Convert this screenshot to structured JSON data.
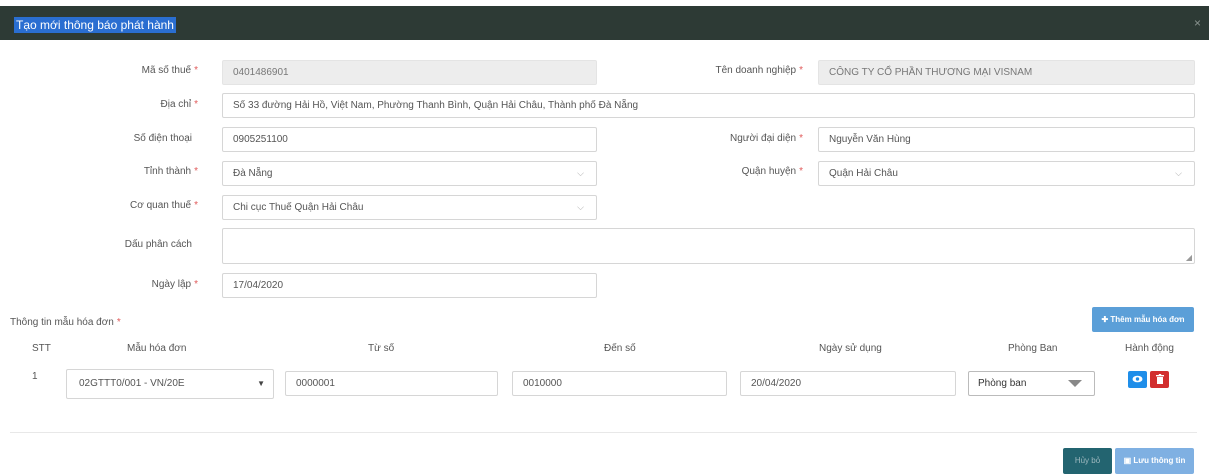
{
  "dialog": {
    "title": "Tạo mới thông báo phát hành",
    "close_icon": "×"
  },
  "form": {
    "mst_label": "Mã số thuế",
    "mst_value": "0401486901",
    "company_label": "Tên doanh nghiệp",
    "company_value": "CÔNG TY CỔ PHẦN THƯƠNG MẠI VISNAM",
    "address_label": "Địa chỉ",
    "address_value": "Số 33 đường Hải Hồ, Việt Nam, Phường Thanh Bình, Quận Hải Châu, Thành phố Đà Nẵng",
    "phone_label": "Số điện thoại",
    "phone_value": "0905251100",
    "rep_label": "Người đại diện",
    "rep_value": "Nguyễn Văn Hùng",
    "province_label": "Tỉnh thành",
    "province_value": "Đà Nẵng",
    "district_label": "Quận huyện",
    "district_value": "Quận Hải Châu",
    "tax_office_label": "Cơ quan thuế",
    "tax_office_value": "Chi cục Thuế Quận Hải Châu",
    "separator_label": "Dấu phân cách",
    "separator_value": "",
    "date_label": "Ngày lập",
    "date_value": "17/04/2020",
    "required_mark": "*",
    "chevron": "⌵"
  },
  "invoice_section": {
    "title": "Thông tin mẫu hóa đơn",
    "add_button": "✚ Thêm mẫu hóa đơn",
    "columns": [
      "STT",
      "Mẫu hóa đơn",
      "Từ số",
      "Đến số",
      "Ngày sử dụng",
      "Phòng Ban",
      "Hành động"
    ],
    "rows": [
      {
        "stt": "1",
        "template": "02GTTT0/001 - VN/20E",
        "from": "0000001",
        "to": "0010000",
        "use_date": "20/04/2020",
        "department": "Phòng ban"
      }
    ],
    "view_icon": "eye-icon",
    "delete_icon": "trash-icon"
  },
  "footer": {
    "cancel_button": "Hủy bỏ",
    "save_button": "Lưu thông tin"
  },
  "colors": {
    "header_bg": "#2d3a35",
    "title_highlight": "#2a6ed1",
    "primary_button": "#5b9fd8",
    "cancel_button": "#236470",
    "view_button": "#1f8ee9",
    "delete_button": "#d22e2e",
    "required": "#e05a5a"
  }
}
